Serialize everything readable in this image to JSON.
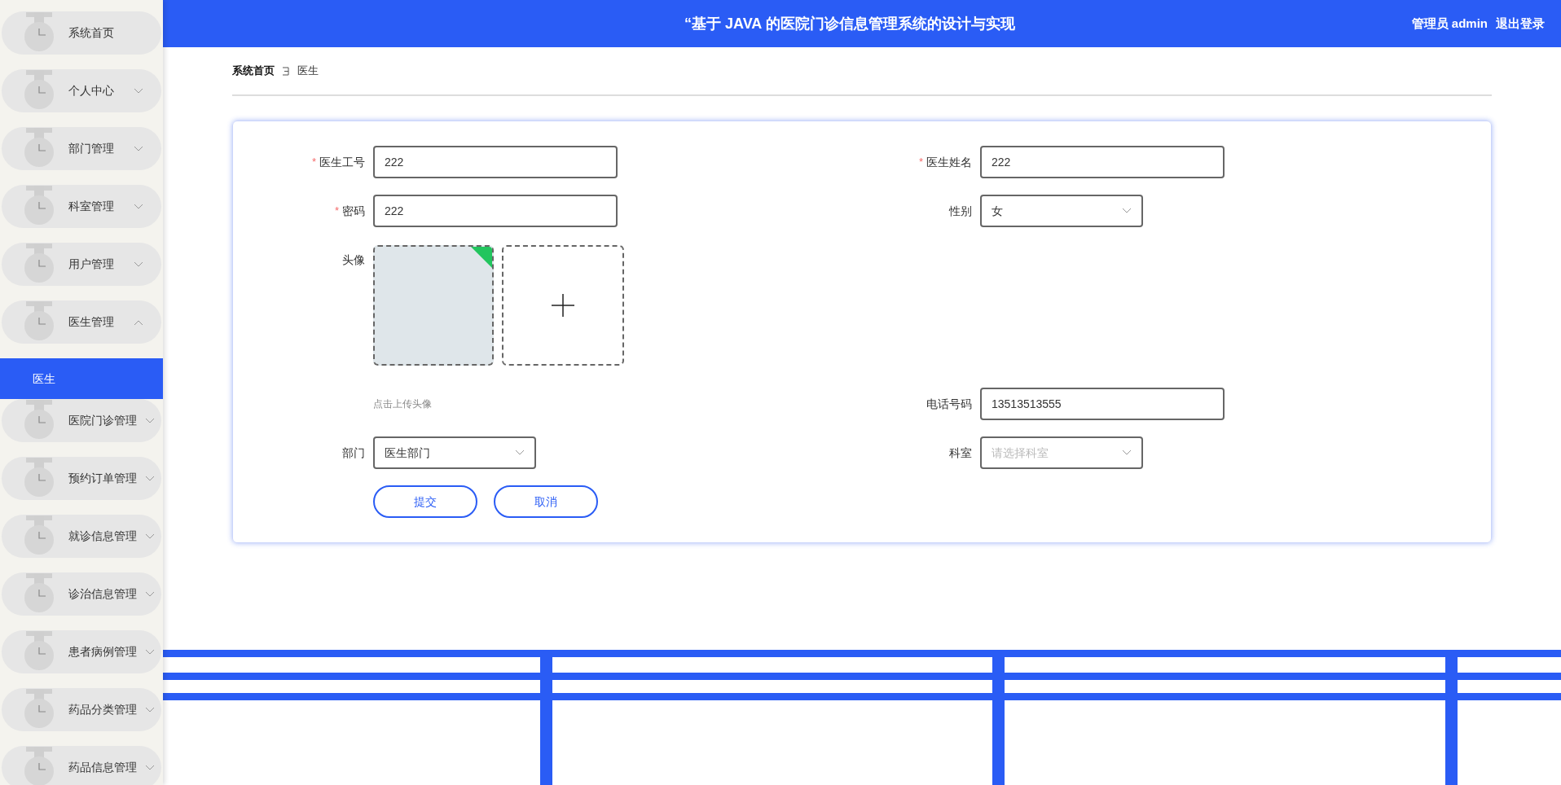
{
  "header": {
    "title": "“基于 JAVA 的医院门诊信息管理系统的设计与实现",
    "user": "管理员 admin",
    "logout": "退出登录"
  },
  "sidebar": {
    "items": [
      {
        "label": "系统首页",
        "kind": "link"
      },
      {
        "label": "个人中心",
        "kind": "group",
        "expanded": false
      },
      {
        "label": "部门管理",
        "kind": "group",
        "expanded": false
      },
      {
        "label": "科室管理",
        "kind": "group",
        "expanded": false
      },
      {
        "label": "用户管理",
        "kind": "group",
        "expanded": false
      },
      {
        "label": "医生管理",
        "kind": "group",
        "expanded": true,
        "children": [
          {
            "label": "医生",
            "selected": true
          }
        ]
      },
      {
        "label": "医院门诊管理",
        "kind": "group",
        "expanded": false
      },
      {
        "label": "预约订单管理",
        "kind": "group",
        "expanded": false
      },
      {
        "label": "就诊信息管理",
        "kind": "group",
        "expanded": false
      },
      {
        "label": "诊治信息管理",
        "kind": "group",
        "expanded": false
      },
      {
        "label": "患者病例管理",
        "kind": "group",
        "expanded": false
      },
      {
        "label": "药品分类管理",
        "kind": "group",
        "expanded": false
      },
      {
        "label": "药品信息管理",
        "kind": "group",
        "expanded": false
      }
    ]
  },
  "breadcrumb": [
    "系统首页",
    "医生"
  ],
  "form": {
    "rows": [
      {
        "left": {
          "kind": "text",
          "label": "医生工号",
          "required_mark": "*",
          "value": "222"
        },
        "right": {
          "kind": "text",
          "label": "医生姓名",
          "required_mark": "*",
          "value": "222"
        }
      },
      {
        "left": {
          "kind": "text",
          "label": "密码",
          "required_mark": "*",
          "value": "222"
        },
        "right": {
          "kind": "select",
          "label": "性别",
          "value": "女"
        }
      },
      {
        "left": {
          "kind": "upload",
          "label": "头像",
          "uploaded": true
        }
      },
      {
        "left": {
          "kind": "note",
          "text": "点击上传头像"
        },
        "right": {
          "kind": "text",
          "label": "电话号码",
          "value": "13513513555"
        }
      },
      {
        "left": {
          "kind": "select",
          "label": "部门",
          "value": "医生部门"
        },
        "right": {
          "kind": "select",
          "label": "科室",
          "placeholder": "请选择科室"
        }
      }
    ],
    "buttons": [
      "提交",
      "取消"
    ]
  }
}
